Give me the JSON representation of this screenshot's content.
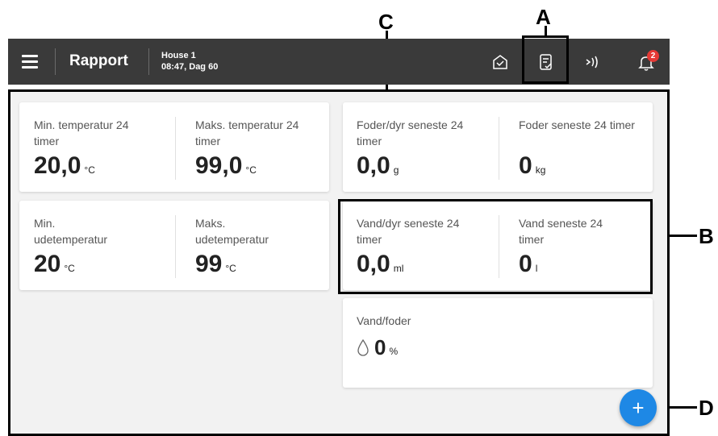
{
  "header": {
    "title": "Rapport",
    "house": "House 1",
    "datetime": "08:47, Dag 60",
    "notification_count": "2"
  },
  "cards": {
    "temp": {
      "min_label": "Min. temperatur 24 timer",
      "min_value": "20,0",
      "min_unit": "°C",
      "max_label": "Maks. temperatur 24 timer",
      "max_value": "99,0",
      "max_unit": "°C"
    },
    "outdoor": {
      "min_label": "Min. udetemperatur",
      "min_value": "20",
      "min_unit": "°C",
      "max_label": "Maks. udetemperatur",
      "max_value": "99",
      "max_unit": "°C"
    },
    "feed": {
      "per_animal_label": "Foder/dyr seneste 24 timer",
      "per_animal_value": "0,0",
      "per_animal_unit": "g",
      "total_label": "Foder seneste 24 timer",
      "total_value": "0",
      "total_unit": "kg"
    },
    "water": {
      "per_animal_label": "Vand/dyr seneste 24 timer",
      "per_animal_value": "0,0",
      "per_animal_unit": "ml",
      "total_label": "Vand seneste 24 timer",
      "total_value": "0",
      "total_unit": "l"
    },
    "ratio": {
      "label": "Vand/foder",
      "value": "0",
      "unit": "%",
      "icon": "water-drop-icon"
    }
  },
  "fab_label": "+",
  "callouts": {
    "a": "A",
    "b": "B",
    "c": "C",
    "d": "D"
  },
  "colors": {
    "topbar": "#3a3a3a",
    "accent": "#1e88e5",
    "badge": "#e53935",
    "background": "#f2f2f2"
  }
}
